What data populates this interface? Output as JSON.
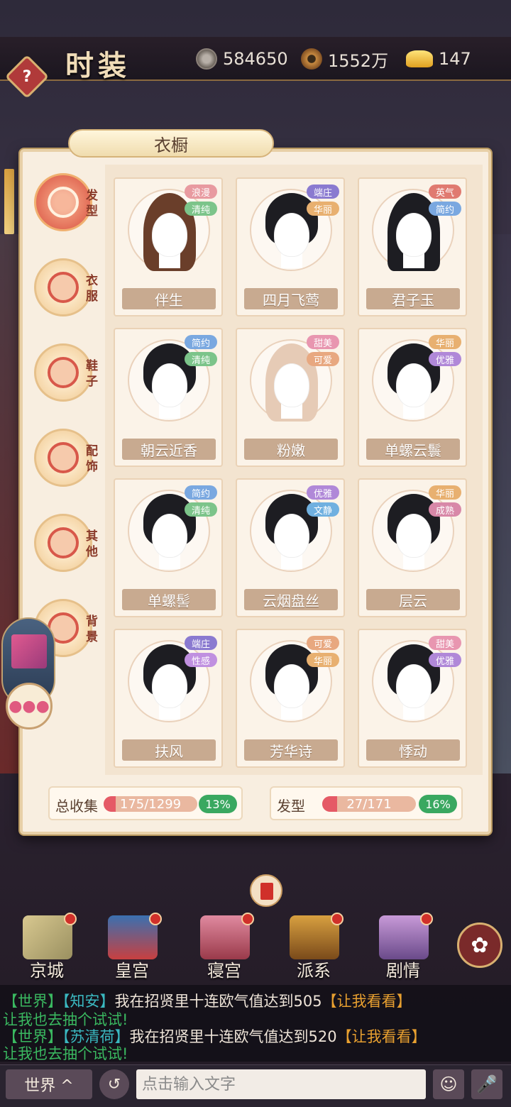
{
  "header": {
    "title": "时装",
    "help_label": "?",
    "resources": [
      {
        "icon": "silver-coin-icon",
        "value": "584650"
      },
      {
        "icon": "copper-coin-icon",
        "value": "1552万"
      },
      {
        "icon": "gold-ingot-icon",
        "value": "147"
      }
    ]
  },
  "panel": {
    "tab_title": "衣橱"
  },
  "categories": [
    {
      "label": "发型",
      "icon": "hairstyle-icon",
      "active": true
    },
    {
      "label": "衣服",
      "icon": "clothes-icon",
      "active": false
    },
    {
      "label": "鞋子",
      "icon": "shoes-icon",
      "active": false
    },
    {
      "label": "配饰",
      "icon": "accessory-icon",
      "active": false
    },
    {
      "label": "其他",
      "icon": "knot-icon",
      "active": false
    },
    {
      "label": "背景",
      "icon": "background-icon",
      "active": false
    }
  ],
  "hairstyles": [
    {
      "name": "伴生",
      "tags": [
        "浪漫",
        "清纯"
      ]
    },
    {
      "name": "四月飞莺",
      "tags": [
        "端庄",
        "华丽"
      ]
    },
    {
      "name": "君子玉",
      "tags": [
        "英气",
        "简约"
      ]
    },
    {
      "name": "朝云近香",
      "tags": [
        "简约",
        "清纯"
      ]
    },
    {
      "name": "粉嫩",
      "tags": [
        "甜美",
        "可爱"
      ]
    },
    {
      "name": "单螺云鬟",
      "tags": [
        "华丽",
        "优雅"
      ]
    },
    {
      "name": "单螺髻",
      "tags": [
        "简约",
        "清纯"
      ]
    },
    {
      "name": "云烟盘丝",
      "tags": [
        "优雅",
        "文静"
      ]
    },
    {
      "name": "层云",
      "tags": [
        "华丽",
        "成熟"
      ]
    },
    {
      "name": "扶风",
      "tags": [
        "端庄",
        "性感"
      ]
    },
    {
      "name": "芳华诗",
      "tags": [
        "可爱",
        "华丽"
      ]
    },
    {
      "name": "悸动",
      "tags": [
        "甜美",
        "优雅"
      ]
    }
  ],
  "tag_colors": {
    "浪漫": "#e89aa0",
    "清纯": "#7cc48a",
    "端庄": "#8a7ad0",
    "华丽": "#e8b070",
    "英气": "#e07a70",
    "简约": "#7aa8e0",
    "甜美": "#e896b0",
    "可爱": "#e8a880",
    "优雅": "#b088d8",
    "文静": "#70b0e0",
    "成熟": "#d888a8",
    "性感": "#c090e0"
  },
  "stats": {
    "total": {
      "label": "总收集",
      "value": "175/1299",
      "percent": "13%",
      "fraction": 0.13
    },
    "hair": {
      "label": "发型",
      "value": "27/171",
      "percent": "16%",
      "fraction": 0.16
    }
  },
  "nav": [
    {
      "label": "京城",
      "icon": "map-icon"
    },
    {
      "label": "皇宫",
      "icon": "palace-icon"
    },
    {
      "label": "寝宫",
      "icon": "bedchamber-icon"
    },
    {
      "label": "派系",
      "icon": "faction-icon"
    },
    {
      "label": "剧情",
      "icon": "story-icon"
    }
  ],
  "chat": [
    {
      "channel": "【世界】",
      "user": "【知安】",
      "message": "我在招贤里十连欧气值达到505",
      "link": "【让我看看】",
      "tail": "让我也去抽个试试!"
    },
    {
      "channel": "【世界】",
      "user": "【苏清荷】",
      "message": "我在招贤里十连欧气值达到520",
      "link": "【让我看看】",
      "tail": "让我也去抽个试试!"
    }
  ],
  "input_bar": {
    "channel_label": "世界 ^",
    "placeholder": "点击输入文字"
  }
}
